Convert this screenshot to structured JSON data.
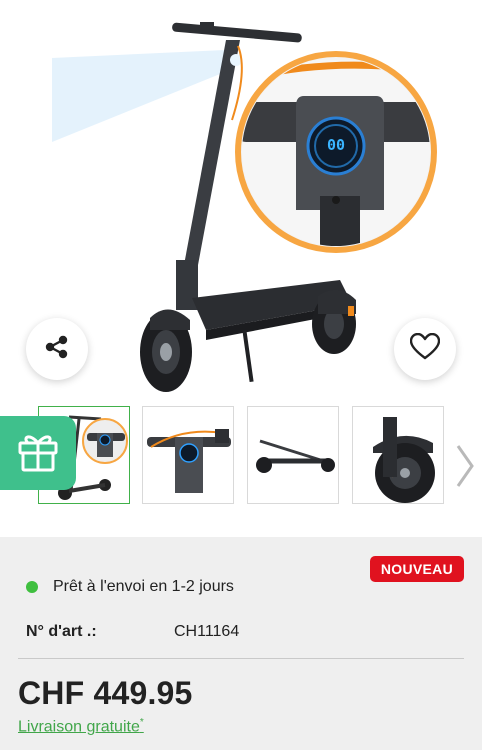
{
  "product": {
    "badge": "NOUVEAU",
    "availability": "Prêt à l'envoi en 1-2 jours",
    "article_label": "N° d'art .:",
    "article_number": "CH11164",
    "price": "CHF 449.95",
    "shipping_label": "Livraison gratuite",
    "shipping_mark": "*",
    "display_reading": "00"
  },
  "icons": {
    "share": "share-icon",
    "favorite": "heart-icon",
    "gift": "gift-icon",
    "next": "chevron-right-icon"
  },
  "colors": {
    "badge": "#e0121f",
    "availability_dot": "#3fbf3f",
    "shipping_link": "#41a64a",
    "active_thumb_border": "#41b14a",
    "gift_tab": "#3fc08c",
    "panel_background": "#efefef"
  },
  "thumbnails": [
    {
      "name": "thumb-1",
      "active": true
    },
    {
      "name": "thumb-2",
      "active": false
    },
    {
      "name": "thumb-3",
      "active": false
    },
    {
      "name": "thumb-4",
      "active": false
    }
  ]
}
